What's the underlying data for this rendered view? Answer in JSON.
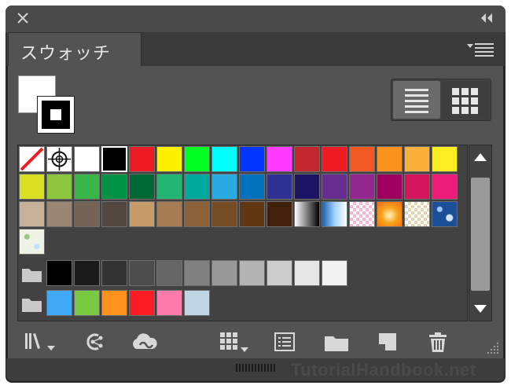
{
  "panel": {
    "title": "スウォッチ",
    "icons": {
      "close": "close-icon",
      "collapse": "double-chevron-left-icon",
      "menu": "panel-menu-icon"
    }
  },
  "view_toggle": {
    "modes": [
      "list-view",
      "thumbnail-view"
    ],
    "active": "list-view"
  },
  "swatches": {
    "row1": [
      "none",
      "registration",
      "#ffffff",
      "#000000",
      "#ed1c24",
      "#fff200",
      "#00ff22",
      "#00ffff",
      "#0036ff",
      "#ff3cff",
      "#c1272d",
      "#ed1c24",
      "#f15a24",
      "#f7931e",
      "#fbb03b",
      "#fcee21"
    ],
    "row2": [
      "#d9e021",
      "#8cc63f",
      "#39b54a",
      "#009245",
      "#006837",
      "#22b573",
      "#00a99d",
      "#29abe2",
      "#0071bc",
      "#2e3192",
      "#1b1464",
      "#662d91",
      "#93278f",
      "#9e005d",
      "#d4145a",
      "#ed1e79"
    ],
    "row3": [
      "#c7b299",
      "#998675",
      "#736357",
      "#534741",
      "#c69c6d",
      "#a67c52",
      "#8c6239",
      "#754c24",
      "#603813",
      "#42210b",
      "gradient-bw",
      "gradient-blue",
      "pattern-pink-check",
      "gradient-orange-radial",
      "pattern-beige-check",
      "pattern-blue-floral"
    ],
    "row4": [
      "pattern-green-floral"
    ],
    "gray_group": [
      "#000000",
      "#1a1a1a",
      "#333333",
      "#4d4d4d",
      "#666666",
      "#808080",
      "#999999",
      "#b3b3b3",
      "#cccccc",
      "#e6e6e6",
      "#f2f2f2"
    ],
    "color_group": [
      "#3fa9f5",
      "#7ac943",
      "#ff931e",
      "#ff1d25",
      "#ff7bac",
      "#c0d6e4"
    ]
  },
  "toolbar": {
    "icons": [
      "swatch-libraries-menu-icon",
      "show-swatch-kinds-icon",
      "cc-library-icon",
      "show-kinds-menu-icon",
      "swatch-options-icon",
      "new-color-group-icon",
      "new-swatch-icon",
      "delete-swatch-icon"
    ]
  },
  "watermark": "TutorialHandbook.net",
  "colors": {
    "panel_bg": "#535353",
    "tab_bg": "#535353",
    "frame_bg": "#262626",
    "swatch_area_bg": "#424242"
  }
}
